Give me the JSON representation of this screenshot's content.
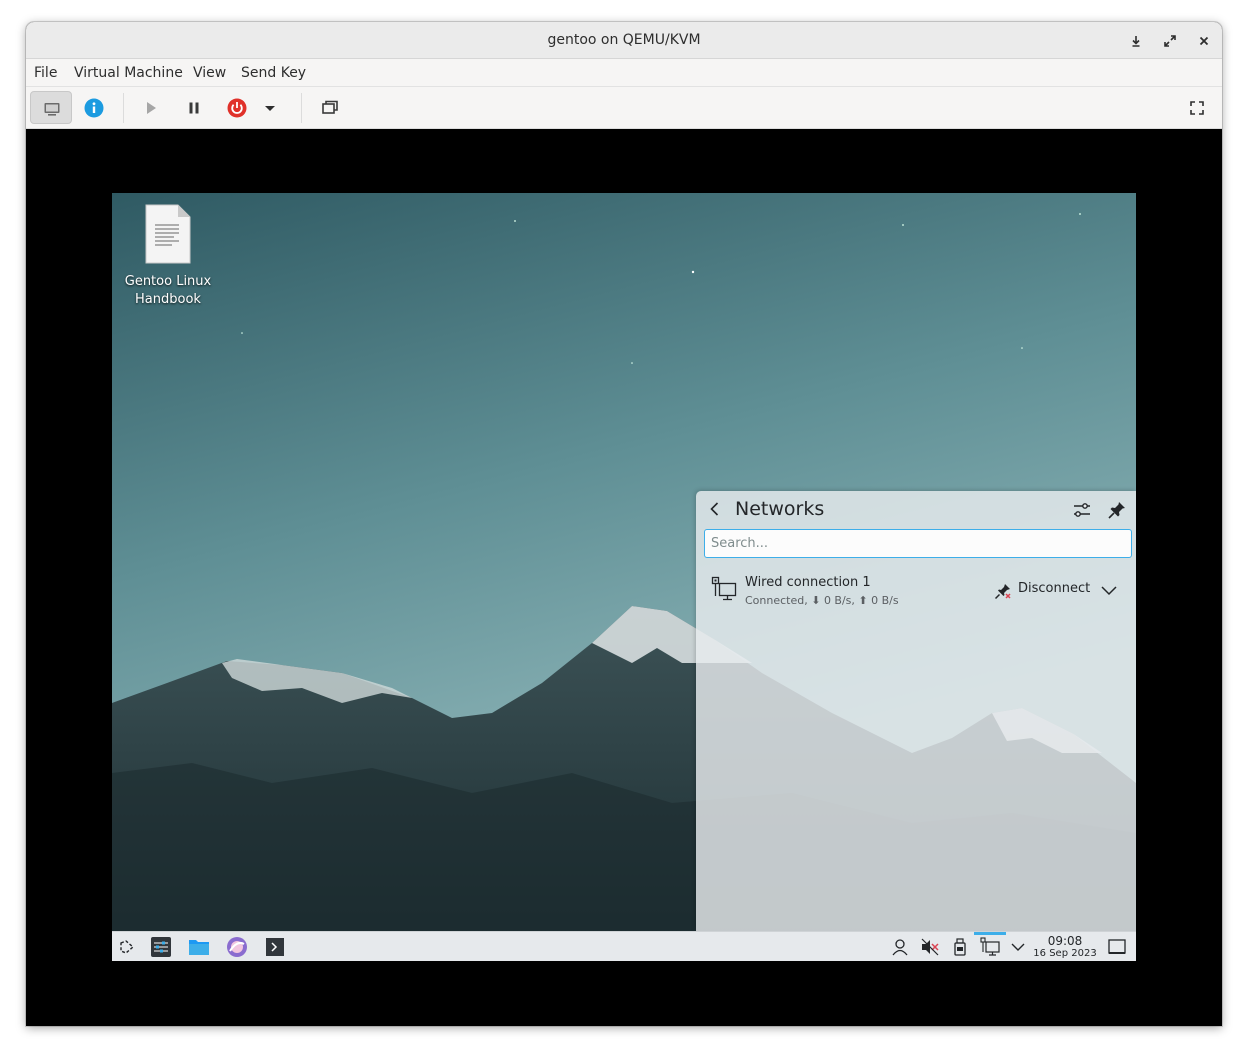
{
  "window": {
    "title": "gentoo on QEMU/KVM"
  },
  "menu": {
    "items": [
      "File",
      "Virtual Machine",
      "View",
      "Send Key"
    ]
  },
  "colors": {
    "accent": "#3daee9",
    "info": "#1c9be0",
    "power": "#e0312a"
  },
  "desktop": {
    "icon_label_line1": "Gentoo Linux",
    "icon_label_line2": "Handbook"
  },
  "networks": {
    "title": "Networks",
    "search_placeholder": "Search...",
    "connection": {
      "name": "Wired connection 1",
      "status": "Connected, ⬇ 0 B/s, ⬆ 0 B/s",
      "action": "Disconnect"
    }
  },
  "taskbar": {
    "time": "09:08",
    "date": "16 Sep 2023"
  }
}
